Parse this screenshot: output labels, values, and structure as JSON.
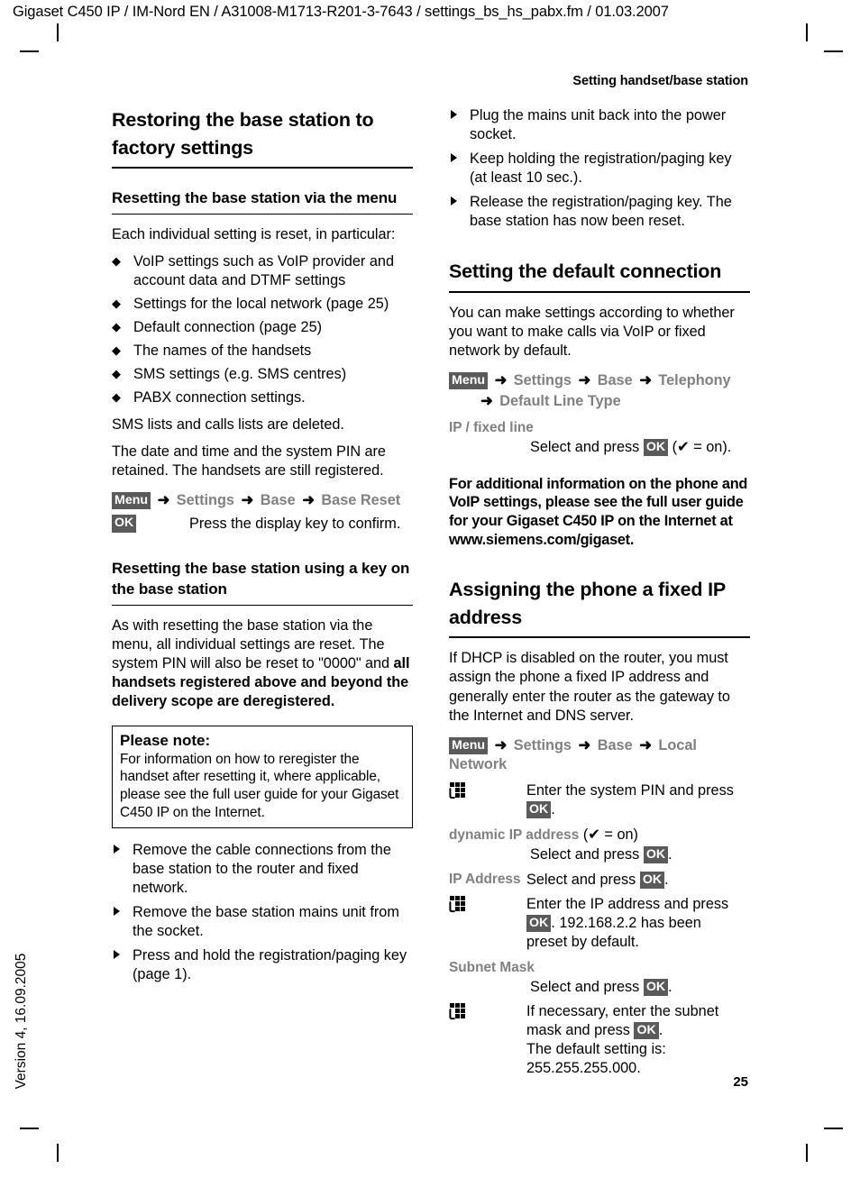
{
  "document": {
    "header": "Gigaset C450 IP / IM-Nord EN / A31008-M1713-R201-3-7643 / settings_bs_hs_pabx.fm / 01.03.2007",
    "running_head": "Setting handset/base station",
    "side_version": "Version 4, 16.09.2005",
    "page_number": "25"
  },
  "left_column": {
    "title": "Restoring the base station to factory settings",
    "sub1": {
      "title": "Resetting the base station via the menu",
      "intro": "Each individual setting is reset, in particular:",
      "bullets": [
        "VoIP settings such as VoIP provider and account data and DTMF settings",
        "Settings for the local network (page 25)",
        "Default connection (page 25)",
        "The names of the handsets",
        "SMS settings (e.g. SMS centres)",
        "PABX connection settings."
      ],
      "para1": "SMS lists and calls lists are deleted.",
      "para2": "The date and time and the system PIN are retained. The handsets are still registered.",
      "menu_path": {
        "badge": "Menu",
        "arrow": "➜",
        "items": [
          "Settings",
          "Base",
          "Base Reset"
        ]
      },
      "ok_row": {
        "badge": "OK",
        "text": "Press the display key to confirm."
      }
    },
    "sub2": {
      "title": "Resetting the base station using a key on the base station",
      "para_normal": "As with resetting the base station via the menu, all individual settings are reset. The system PIN will also be reset to \"0000\" and ",
      "para_bold": "all handsets registered above and beyond the delivery scope are deregistered.",
      "note": {
        "title": "Please note:",
        "body": "For information on how to reregister the handset after resetting it, where applicable, please see the full user guide for your Gigaset C450 IP on the Internet."
      },
      "steps": [
        "Remove the cable connections from the base station to the router and fixed network.",
        "Remove the base station mains unit from the socket.",
        "Press and hold the registration/paging key (page 1)."
      ]
    }
  },
  "right_column": {
    "steps_continued": [
      "Plug the mains unit back into the power socket.",
      "Keep holding the registration/paging key (at least 10 sec.).",
      "Release the registration/paging key. The base station has now been reset."
    ],
    "section1": {
      "title": "Setting the default connection",
      "intro": "You can make settings according to whether you want to make calls via VoIP or fixed network by default.",
      "menu_path": {
        "badge": "Menu",
        "arrow": "➜",
        "items": [
          "Settings",
          "Base",
          "Telephony"
        ],
        "second_line": "Default Line Type"
      },
      "option_label": "IP / fixed line",
      "option_desc_pre": "Select and press ",
      "option_badge": "OK",
      "option_desc_post": " (✔ = on).",
      "bold_para": "For additional information on the phone and VoIP settings, please see the full user guide for your Gigaset C450 IP on the Internet at www.siemens.com/gigaset."
    },
    "section2": {
      "title": "Assigning the phone a fixed IP address",
      "intro": "If DHCP is disabled on the router, you must assign the phone a fixed IP address and generally enter the router as the gateway to the Internet and DNS server.",
      "menu_path": {
        "badge": "Menu",
        "arrow": "➜",
        "items": [
          "Settings",
          "Base",
          "Local Network"
        ]
      },
      "rows": [
        {
          "icon": "keypad-icon",
          "label": "",
          "desc_pre": "Enter the system PIN and press ",
          "badge": "OK",
          "desc_post": "."
        },
        {
          "label": "dynamic IP address",
          "label_suffix": " (✔ = on)",
          "desc_pre": "Select and press ",
          "badge": "OK",
          "desc_post": "."
        },
        {
          "label": "IP Address",
          "desc_pre": "Select and press ",
          "badge": "OK",
          "desc_post": "."
        },
        {
          "icon": "keypad-icon",
          "desc_pre": "Enter the IP address and press ",
          "badge": "OK",
          "desc_post": ". 192.168.2.2 has been preset by default."
        },
        {
          "label": "Subnet Mask",
          "desc_pre": "Select and press ",
          "badge": "OK",
          "desc_post": "."
        },
        {
          "icon": "keypad-icon",
          "desc_pre": "If necessary, enter the subnet mask and press ",
          "badge": "OK",
          "desc_post": ".",
          "desc_extra": "The default setting is: 255.255.255.000."
        }
      ]
    }
  },
  "colors": {
    "badge_background": "#5a5a5a",
    "menu_text": "#808080",
    "text": "#000000"
  }
}
